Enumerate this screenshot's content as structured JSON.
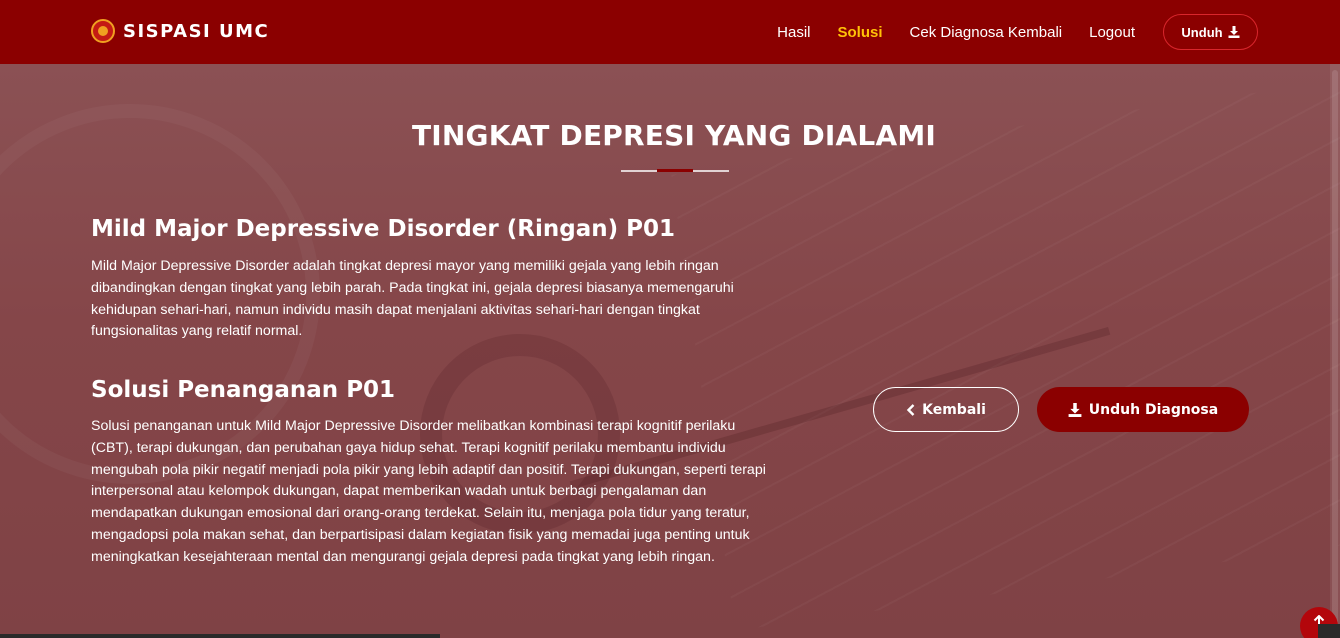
{
  "brand": {
    "name": "SISPASI UMC"
  },
  "nav": {
    "items": [
      {
        "label": "Hasil"
      },
      {
        "label": "Solusi"
      },
      {
        "label": "Cek Diagnosa Kembali"
      },
      {
        "label": "Logout"
      }
    ],
    "active": "Solusi",
    "download_label": "Unduh"
  },
  "section": {
    "title": "TINGKAT DEPRESI YANG DIALAMI"
  },
  "diagnosis": {
    "heading": "Mild Major Depressive Disorder (Ringan) P01",
    "description": "Mild Major Depressive Disorder adalah tingkat depresi mayor yang memiliki gejala yang lebih ringan dibandingkan dengan tingkat yang lebih parah. Pada tingkat ini, gejala depresi biasanya memengaruhi kehidupan sehari-hari, namun individu masih dapat menjalani aktivitas sehari-hari dengan tingkat fungsionalitas yang relatif normal."
  },
  "solution": {
    "heading": "Solusi Penanganan P01",
    "description": "Solusi penanganan untuk Mild Major Depressive Disorder melibatkan kombinasi terapi kognitif perilaku (CBT), terapi dukungan, dan perubahan gaya hidup sehat. Terapi kognitif perilaku membantu individu mengubah pola pikir negatif menjadi pola pikir yang lebih adaptif dan positif. Terapi dukungan, seperti terapi interpersonal atau kelompok dukungan, dapat memberikan wadah untuk berbagi pengalaman dan mendapatkan dukungan emosional dari orang-orang terdekat. Selain itu, menjaga pola tidur yang teratur, mengadopsi pola makan sehat, dan berpartisipasi dalam kegiatan fisik yang memadai juga penting untuk meningkatkan kesejahteraan mental dan mengurangi gejala depresi pada tingkat yang lebih ringan."
  },
  "actions": {
    "back_label": "Kembali",
    "download_label": "Unduh Diagnosa"
  },
  "colors": {
    "navbar": "#8b0000",
    "active_nav": "#ffc107",
    "primary_button": "#8b0000",
    "back_to_top": "#b3060b"
  },
  "icons": {
    "brand": "brand-logo-icon",
    "download": "download-icon",
    "back": "chevron-left-icon",
    "back_to_top": "arrow-up-icon"
  }
}
